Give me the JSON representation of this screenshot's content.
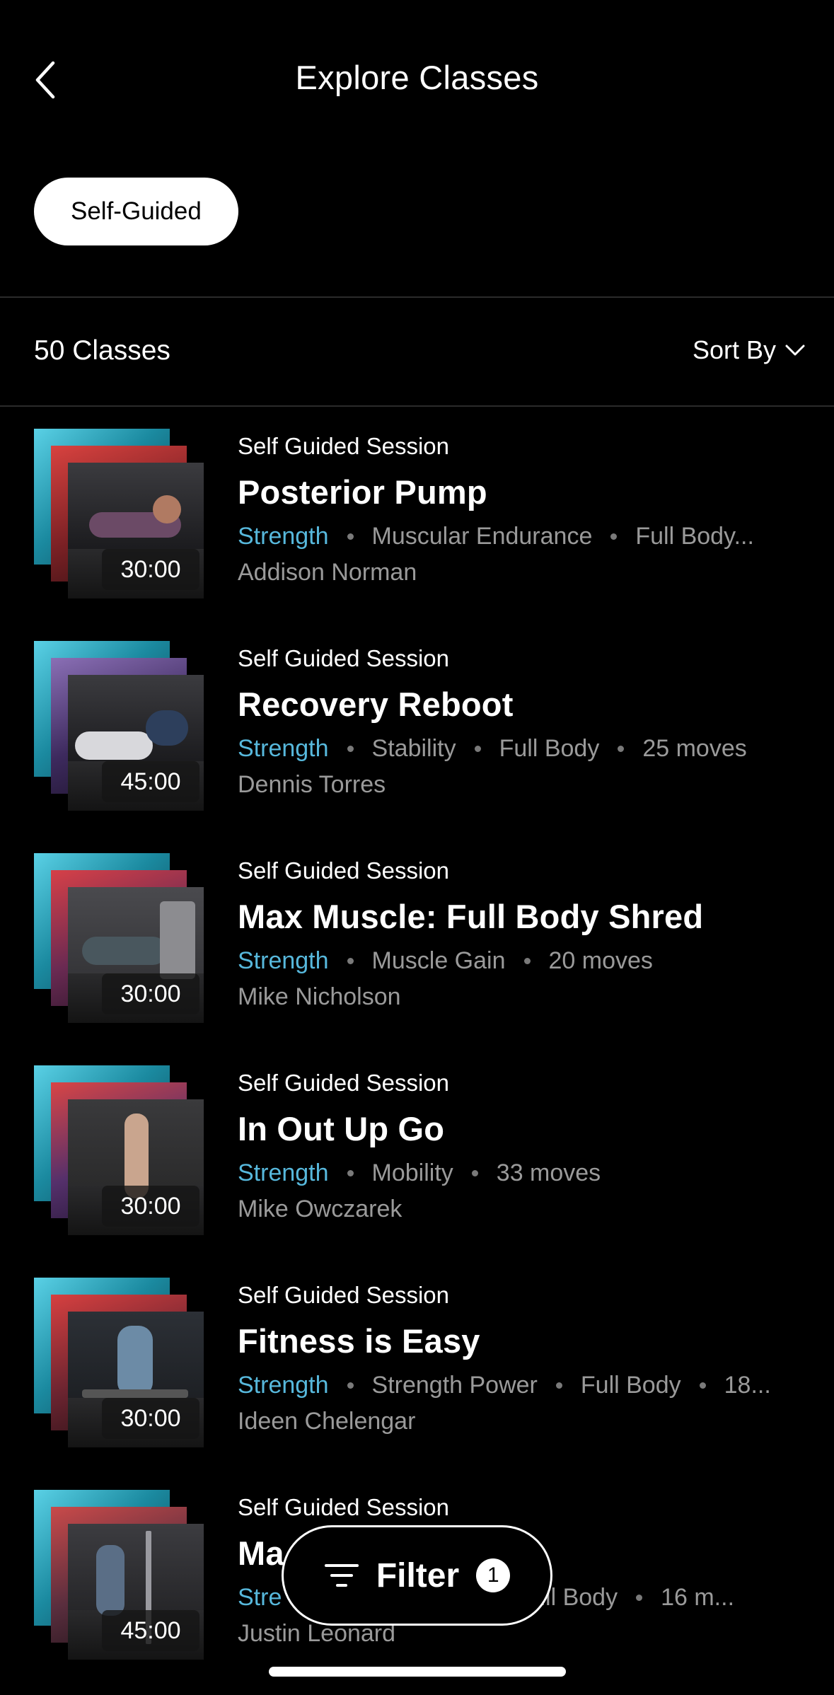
{
  "header": {
    "title": "Explore Classes",
    "back_icon": "chevron-left-icon"
  },
  "chip": {
    "label": "Self-Guided"
  },
  "list_header": {
    "count": "50 Classes",
    "sort_label": "Sort By",
    "sort_icon": "chevron-down-icon"
  },
  "classes": [
    {
      "session": "Self Guided Session",
      "title": "Posterior Pump",
      "category": "Strength",
      "tags": [
        "Muscular Endurance",
        "Full Body..."
      ],
      "instructor": "Addison Norman",
      "duration": "30:00"
    },
    {
      "session": "Self Guided Session",
      "title": "Recovery Reboot",
      "category": "Strength",
      "tags": [
        "Stability",
        "Full Body",
        "25 moves"
      ],
      "instructor": "Dennis Torres",
      "duration": "45:00"
    },
    {
      "session": "Self Guided Session",
      "title": "Max Muscle: Full Body Shred",
      "category": "Strength",
      "tags": [
        "Muscle Gain",
        "20 moves"
      ],
      "instructor": "Mike Nicholson",
      "duration": "30:00"
    },
    {
      "session": "Self Guided Session",
      "title": "In Out Up Go",
      "category": "Strength",
      "tags": [
        "Mobility",
        "33 moves"
      ],
      "instructor": "Mike Owczarek",
      "duration": "30:00"
    },
    {
      "session": "Self Guided Session",
      "title": "Fitness is Easy",
      "category": "Strength",
      "tags": [
        "Strength Power",
        "Full Body",
        "18..."
      ],
      "instructor": "Ideen Chelengar",
      "duration": "30:00"
    },
    {
      "session": "Self Guided Session",
      "title": "Ma",
      "category": "Stre",
      "tags": [
        "",
        "Full Body",
        "16 m..."
      ],
      "instructor": "Justin Leonard",
      "duration": "45:00"
    }
  ],
  "filter": {
    "label": "Filter",
    "badge": "1",
    "icon": "filter-lines-icon"
  },
  "colors": {
    "accent": "#57b8dc",
    "background": "#000000",
    "muted": "#9a9a9a"
  }
}
